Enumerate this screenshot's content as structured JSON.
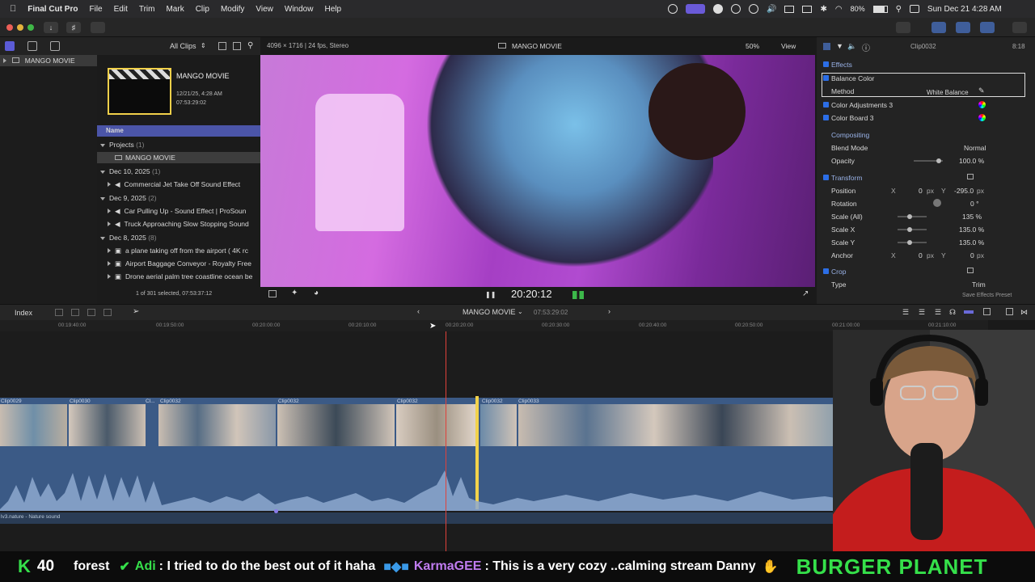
{
  "menubar": {
    "app": "Final Cut Pro",
    "items": [
      "File",
      "Edit",
      "Trim",
      "Mark",
      "Clip",
      "Modify",
      "View",
      "Window",
      "Help"
    ],
    "battery": "80%",
    "datetime": "Sun Dec 21  4:28 AM"
  },
  "browser_bar": {
    "clips_filter": "All Clips",
    "format_info": "4096 × 1716 | 24 fps, Stereo"
  },
  "sidebar": {
    "library_item": "MANGO MOVIE"
  },
  "browser": {
    "project": {
      "title": "MANGO MOVIE",
      "date": "12/21/25, 4:28 AM",
      "duration": "07:53:29:02"
    },
    "column_header": "Name",
    "groups": [
      {
        "label": "Projects",
        "count": "(1)",
        "items": [
          "MANGO MOVIE"
        ]
      },
      {
        "label": "Dec 10, 2025",
        "count": "(1)",
        "items": [
          "Commercial Jet Take Off Sound Effect"
        ]
      },
      {
        "label": "Dec 9, 2025",
        "count": "(2)",
        "items": [
          "Car Pulling Up - Sound Effect  |  ProSoun",
          "Truck Approaching Slow Stopping Sound"
        ]
      },
      {
        "label": "Dec 8, 2025",
        "count": "(8)",
        "items": [
          "a plane taking off from the airport ( 4K rc",
          "Airport Baggage Conveyor - Royalty Free",
          "Drone aerial palm tree coastline ocean be"
        ]
      }
    ],
    "status": "1 of 301 selected, 07:53:37:12"
  },
  "viewer": {
    "title": "MANGO MOVIE",
    "zoom": "50%",
    "view_menu": "View",
    "timecode": "20:20:12"
  },
  "inspector": {
    "clip_name": "Clip0032",
    "clip_duration": "8:18",
    "effects_header": "Effects",
    "balance_color": "Balance Color",
    "method_label": "Method",
    "method_value": "White Balance",
    "color_adjustments": "Color Adjustments 3",
    "color_board": "Color Board 3",
    "compositing": "Compositing",
    "blend_mode_label": "Blend Mode",
    "blend_mode_value": "Normal",
    "opacity_label": "Opacity",
    "opacity_value": "100.0 %",
    "transform": "Transform",
    "position_label": "Position",
    "pos_x_label": "X",
    "pos_x": "0",
    "pos_x_unit": "px",
    "pos_y_label": "Y",
    "pos_y": "-295.0",
    "pos_y_unit": "px",
    "rotation_label": "Rotation",
    "rotation_value": "0 °",
    "scale_all_label": "Scale (All)",
    "scale_all_value": "135 %",
    "scale_x_label": "Scale X",
    "scale_x_value": "135.0 %",
    "scale_y_label": "Scale Y",
    "scale_y_value": "135.0 %",
    "anchor_label": "Anchor",
    "anchor_x_label": "X",
    "anchor_x": "0",
    "anchor_x_unit": "px",
    "anchor_y_label": "Y",
    "anchor_y": "0",
    "anchor_y_unit": "px",
    "crop": "Crop",
    "type_label": "Type",
    "type_value": "Trim",
    "save_preset": "Save Effects Preset"
  },
  "timeline": {
    "index_label": "Index",
    "project_name": "MANGO MOVIE",
    "duration": "07:53:29:02",
    "ruler": [
      "00:19:40:00",
      "00:19:50:00",
      "00:20:00:00",
      "00:20:10:00",
      "00:20:20:00",
      "00:20:30:00",
      "00:20:40:00",
      "00:20:50:00",
      "00:21:00:00",
      "00:21:10:00"
    ],
    "clips": [
      "Clip0029",
      "Clip0030",
      "Cl...",
      "Clip0032",
      "Clip0032",
      "Clip0032",
      "Clip0032",
      "Clip0033"
    ],
    "audio_label": "lv3.nature - Nature sound"
  },
  "ticker": {
    "count_prefix": "K",
    "count": "40",
    "text1": "forest",
    "user1": "Adi",
    "msg1": ": I tried to do the best out of it haha",
    "user2": "KarmaGEE",
    "msg2": ": This is a very cozy ..calming stream Danny",
    "brand": "BURGER PLANET"
  },
  "colors": {
    "accent": "#2c6ee6",
    "clip_blue": "#3b5a86",
    "audio_wave": "#8ea9cf",
    "playhead": "#e0413a",
    "selection": "#f2d24b",
    "ticker_green": "#35e04a",
    "ticker_purple": "#c07cf0"
  }
}
